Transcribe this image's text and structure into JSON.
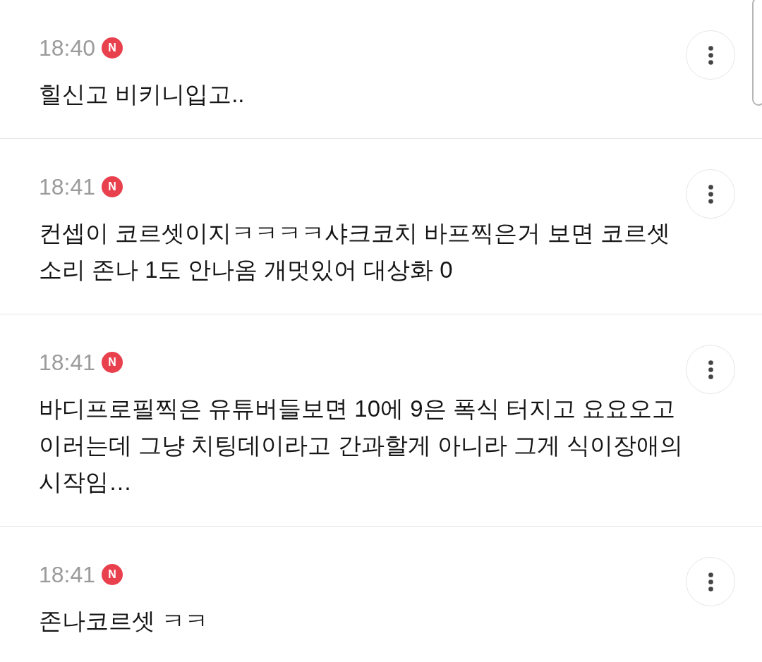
{
  "comments": [
    {
      "time": "18:40",
      "badge": "N",
      "text": "힐신고 비키니입고.."
    },
    {
      "time": "18:41",
      "badge": "N",
      "text": "컨셉이 코르셋이지ㅋㅋㅋㅋ샤크코치 바프찍은거 보면 코르셋 소리 존나 1도 안나옴 개멋있어 대상화 0"
    },
    {
      "time": "18:41",
      "badge": "N",
      "text": "바디프로필찍은 유튜버들보면 10에 9은 폭식 터지고 요요오고 이러는데 그냥 치팅데이라고 간과할게 아니라 그게 식이장애의 시작임…"
    },
    {
      "time": "18:41",
      "badge": "N",
      "text": "존나코르셋 ㅋㅋ"
    }
  ]
}
